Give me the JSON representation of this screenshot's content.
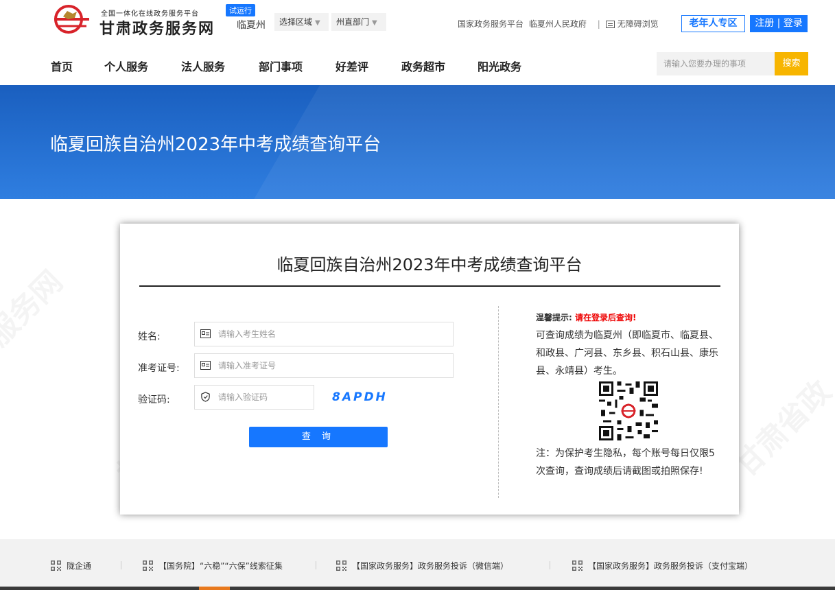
{
  "header": {
    "logo_sub": "全国一体化在线政务服务平台",
    "logo_title": "甘肃政务服务网",
    "trial_badge": "试运行",
    "city": "临夏州",
    "region_select": "选择区域",
    "dept_select": "州直部门",
    "link_national": "国家政务服务平台",
    "link_gov": "临夏州人民政府",
    "link_accessible": "无障碍浏览",
    "elder_zone": "老年人专区",
    "register_login": "注册 | 登录"
  },
  "nav": {
    "items": [
      "首页",
      "个人服务",
      "法人服务",
      "部门事项",
      "好差评",
      "政务超市",
      "阳光政务"
    ]
  },
  "search": {
    "placeholder": "请输入您要办理的事项",
    "button": "搜索"
  },
  "banner": {
    "title": "临夏回族自治州2023年中考成绩查询平台"
  },
  "card": {
    "title": "临夏回族自治州2023年中考成绩查询平台",
    "form": {
      "name_label": "姓名:",
      "name_placeholder": "请输入考生姓名",
      "ticket_label": "准考证号:",
      "ticket_placeholder": "请输入准考证号",
      "captcha_label": "验证码:",
      "captcha_placeholder": "请输入验证码",
      "captcha_code": "8APDH",
      "submit": "查 询"
    },
    "tips": {
      "head": "温馨提示:",
      "warning": "请在登录后查询!",
      "body": "可查询成绩为临夏州（即临夏市、临夏县、和政县、广河县、东乡县、积石山县、康乐县、永靖县）考生。",
      "note": "注：为保护考生隐私，每个账号每日仅限5次查询，查询成绩后请截图或拍照保存!"
    }
  },
  "footer": {
    "links": [
      "陇企通",
      "【国务院】“六稳”“六保”线索征集",
      "【国家政务服务】政务服务投诉（微信端）",
      "【国家政务服务】政务服务投诉（支付宝端）"
    ]
  },
  "colors": {
    "primary": "#1677ff",
    "search_button": "#f7b500",
    "warning": "#ee0000",
    "banner": "#2a72d8"
  }
}
